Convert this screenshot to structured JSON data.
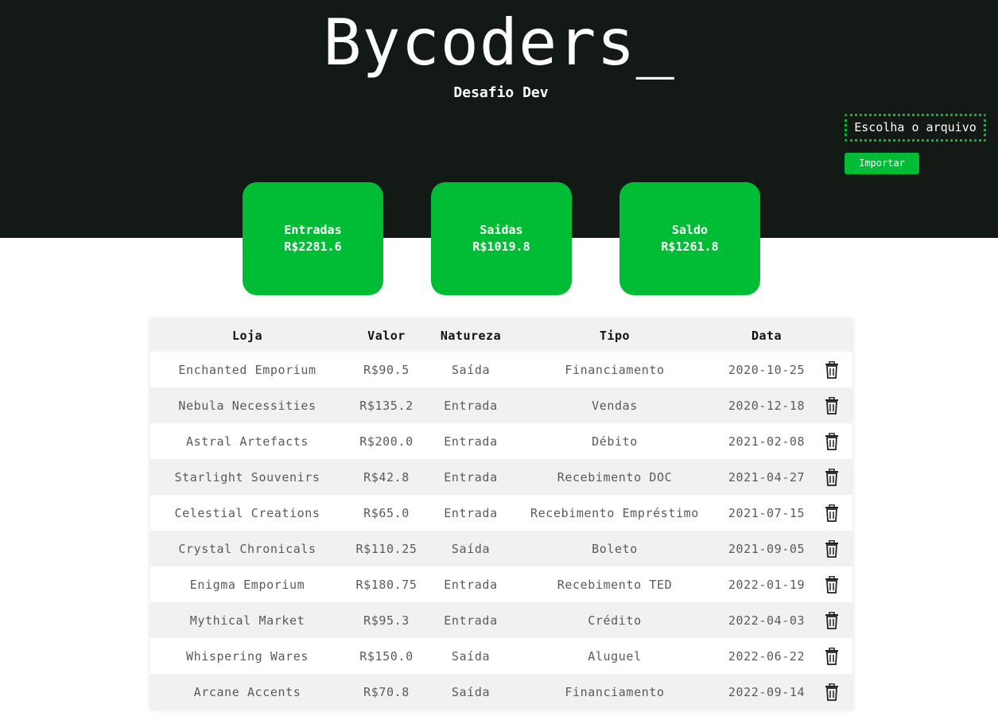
{
  "header": {
    "brand": "Bycoders_",
    "subtitle": "Desafio Dev",
    "file_picker_label": "Escolha o arquivo",
    "import_label": "Importar"
  },
  "summary": [
    {
      "label": "Entradas",
      "value": "R$2281.6"
    },
    {
      "label": "Saidas",
      "value": "R$1019.8"
    },
    {
      "label": "Saldo",
      "value": "R$1261.8"
    }
  ],
  "table": {
    "columns": [
      "Loja",
      "Valor",
      "Natureza",
      "Tipo",
      "Data"
    ],
    "rows": [
      {
        "loja": "Enchanted Emporium",
        "valor": "R$90.5",
        "natureza": "Saída",
        "tipo": "Financiamento",
        "data": "2020-10-25"
      },
      {
        "loja": "Nebula Necessities",
        "valor": "R$135.2",
        "natureza": "Entrada",
        "tipo": "Vendas",
        "data": "2020-12-18"
      },
      {
        "loja": "Astral Artefacts",
        "valor": "R$200.0",
        "natureza": "Entrada",
        "tipo": "Débito",
        "data": "2021-02-08"
      },
      {
        "loja": "Starlight Souvenirs",
        "valor": "R$42.8",
        "natureza": "Entrada",
        "tipo": "Recebimento DOC",
        "data": "2021-04-27"
      },
      {
        "loja": "Celestial Creations",
        "valor": "R$65.0",
        "natureza": "Entrada",
        "tipo": "Recebimento Empréstimo",
        "data": "2021-07-15"
      },
      {
        "loja": "Crystal Chronicals",
        "valor": "R$110.25",
        "natureza": "Saída",
        "tipo": "Boleto",
        "data": "2021-09-05"
      },
      {
        "loja": "Enigma Emporium",
        "valor": "R$180.75",
        "natureza": "Entrada",
        "tipo": "Recebimento TED",
        "data": "2022-01-19"
      },
      {
        "loja": "Mythical Market",
        "valor": "R$95.3",
        "natureza": "Entrada",
        "tipo": "Crédito",
        "data": "2022-04-03"
      },
      {
        "loja": "Whispering Wares",
        "valor": "R$150.0",
        "natureza": "Saída",
        "tipo": "Aluguel",
        "data": "2022-06-22"
      },
      {
        "loja": "Arcane Accents",
        "valor": "R$70.8",
        "natureza": "Saída",
        "tipo": "Financiamento",
        "data": "2022-09-14"
      }
    ]
  },
  "icons": {
    "row_action": "trash-icon"
  },
  "colors": {
    "header_bg": "#131a15",
    "accent": "#00bd35"
  }
}
